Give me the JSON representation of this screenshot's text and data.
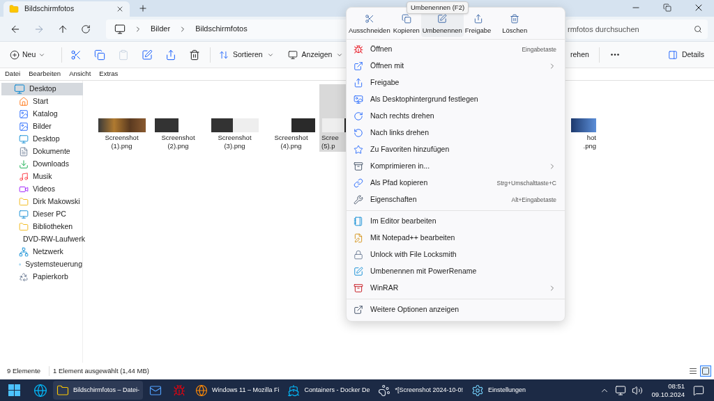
{
  "tab": {
    "title": "Bildschirmfotos"
  },
  "address": {
    "crumbs": [
      "Bilder",
      "Bildschirmfotos"
    ],
    "search_placeholder": "rmfotos durchsuchen"
  },
  "toolbar": {
    "new": "Neu",
    "sort": "Sortieren",
    "view": "Anzeigen",
    "rotate": "rehen",
    "details": "Details"
  },
  "menubar": [
    "Datei",
    "Bearbeiten",
    "Ansicht",
    "Extras"
  ],
  "sidebar": {
    "items": [
      {
        "label": "Desktop",
        "selected": true,
        "children": [
          {
            "label": "Start",
            "selected": false
          },
          {
            "label": "Katalog",
            "selected": false
          },
          {
            "label": "Bilder",
            "selected": false
          },
          {
            "label": "Desktop",
            "selected": false
          },
          {
            "label": "Dokumente",
            "selected": false
          },
          {
            "label": "Downloads",
            "selected": false
          },
          {
            "label": "Musik",
            "selected": false
          },
          {
            "label": "Videos",
            "selected": false
          },
          {
            "label": "Dirk Makowski",
            "selected": false
          },
          {
            "label": "Dieser PC",
            "selected": false
          },
          {
            "label": "Bibliotheken",
            "selected": false
          },
          {
            "label": "DVD-RW-Laufwerk",
            "selected": false
          },
          {
            "label": "Netzwerk",
            "selected": false
          },
          {
            "label": "Systemsteuerung",
            "selected": false
          },
          {
            "label": "Papierkorb",
            "selected": false
          }
        ]
      }
    ]
  },
  "files": [
    {
      "lines": [
        "Screenshot",
        "(1).png"
      ],
      "selected": false
    },
    {
      "lines": [
        "Screenshot",
        "(2).png"
      ],
      "selected": false
    },
    {
      "lines": [
        "Screenshot",
        "(3).png"
      ],
      "selected": false
    },
    {
      "lines": [
        "Screenshot",
        "(4).png"
      ],
      "selected": false
    },
    {
      "lines": [
        "Scree",
        "(5).p"
      ],
      "selected": true
    },
    {
      "lines": [
        "hot",
        ".png"
      ],
      "selected": false
    }
  ],
  "context_menu": {
    "tooltip": "Umbenennen (F2)",
    "actions": [
      {
        "label": "Ausschneiden",
        "hovered": false
      },
      {
        "label": "Kopieren",
        "hovered": false
      },
      {
        "label": "Umbenennen",
        "hovered": true
      },
      {
        "label": "Freigabe",
        "hovered": false
      },
      {
        "label": "Löschen",
        "hovered": false
      }
    ],
    "items": [
      {
        "kind": "item",
        "label": "Öffnen",
        "shortcut": "Eingabetaste",
        "submenu": false
      },
      {
        "kind": "item",
        "label": "Öffnen mit",
        "submenu": true
      },
      {
        "kind": "item",
        "label": "Freigabe",
        "submenu": false
      },
      {
        "kind": "item",
        "label": "Als Desktophintergrund festlegen",
        "submenu": false
      },
      {
        "kind": "item",
        "label": "Nach rechts drehen",
        "submenu": false
      },
      {
        "kind": "item",
        "label": "Nach links drehen",
        "submenu": false
      },
      {
        "kind": "item",
        "label": "Zu Favoriten hinzufügen",
        "submenu": false
      },
      {
        "kind": "item",
        "label": "Komprimieren in...",
        "submenu": true
      },
      {
        "kind": "item",
        "label": "Als Pfad kopieren",
        "shortcut": "Strg+Umschalttaste+C",
        "submenu": false
      },
      {
        "kind": "item",
        "label": "Eigenschaften",
        "shortcut": "Alt+Eingabetaste",
        "submenu": false
      },
      {
        "kind": "separator"
      },
      {
        "kind": "item",
        "label": "Im Editor bearbeiten",
        "submenu": false
      },
      {
        "kind": "item",
        "label": "Mit Notepad++ bearbeiten",
        "submenu": false
      },
      {
        "kind": "item",
        "label": "Unlock with File Locksmith",
        "submenu": false
      },
      {
        "kind": "item",
        "label": "Umbenennen mit PowerRename",
        "submenu": false
      },
      {
        "kind": "item",
        "label": "WinRAR",
        "submenu": true
      },
      {
        "kind": "separator"
      },
      {
        "kind": "item",
        "label": "Weitere Optionen anzeigen",
        "submenu": false
      }
    ]
  },
  "status_bar": {
    "count": "9 Elemente",
    "selection": "1 Element ausgewählt (1,44 MB)",
    "views": [
      {
        "kind": "list",
        "selected": false
      },
      {
        "kind": "tiles",
        "selected": true
      }
    ]
  },
  "taskbar": {
    "apps": [
      {
        "kind": "explorer",
        "label": "Bildschirmfotos – Datei-",
        "active": true
      },
      {
        "kind": "mail"
      },
      {
        "kind": "red"
      },
      {
        "kind": "firefox",
        "label": "Windows 11 – Mozilla Fi",
        "active": false
      },
      {
        "kind": "docker",
        "label": "Containers - Docker De",
        "active": false
      },
      {
        "kind": "gimp",
        "label": "*[Screenshot 2024-10-0!",
        "active": false
      },
      {
        "kind": "settings",
        "label": "Einstellungen",
        "active": false
      }
    ],
    "time": "08:51",
    "date": "09.10.2024"
  }
}
